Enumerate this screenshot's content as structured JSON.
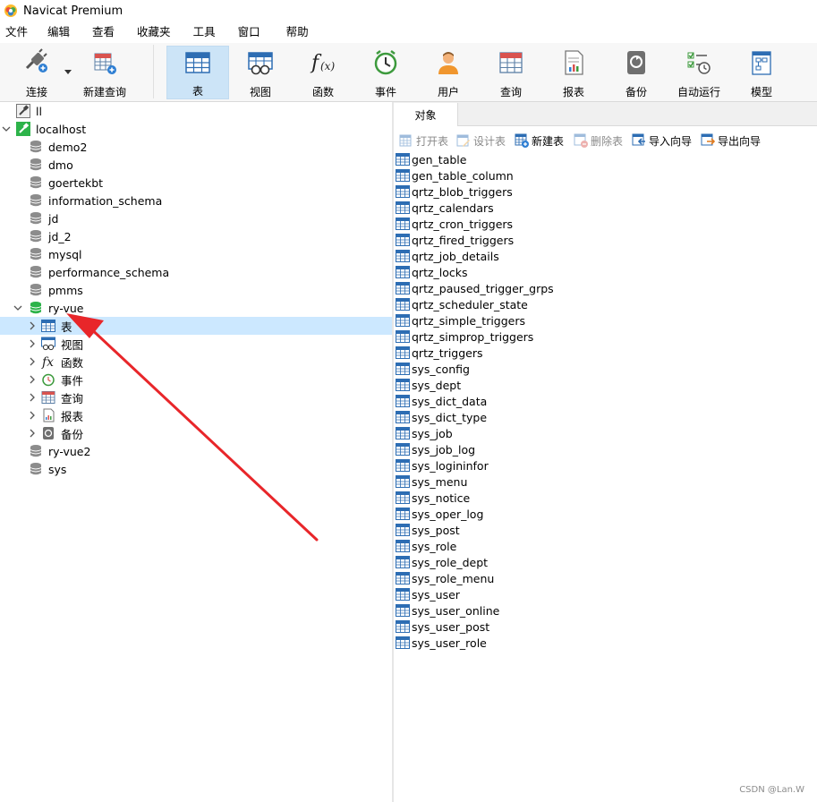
{
  "app": {
    "title": "Navicat Premium"
  },
  "menu": [
    "文件",
    "编辑",
    "查看",
    "收藏夹",
    "工具",
    "窗口",
    "帮助"
  ],
  "toolbar": [
    {
      "label": "连接",
      "icon": "plug-icon"
    },
    {
      "label": "新建查询",
      "icon": "new-query-icon"
    },
    {
      "label": "表",
      "icon": "table-icon",
      "active": true
    },
    {
      "label": "视图",
      "icon": "view-icon"
    },
    {
      "label": "函数",
      "icon": "function-icon"
    },
    {
      "label": "事件",
      "icon": "event-clock-icon"
    },
    {
      "label": "用户",
      "icon": "user-icon"
    },
    {
      "label": "查询",
      "icon": "query-icon"
    },
    {
      "label": "报表",
      "icon": "report-icon"
    },
    {
      "label": "备份",
      "icon": "backup-icon"
    },
    {
      "label": "自动运行",
      "icon": "automation-icon"
    },
    {
      "label": "模型",
      "icon": "model-icon"
    }
  ],
  "tree": {
    "connections": [
      {
        "label": "ll"
      },
      {
        "label": "localhost"
      }
    ],
    "databases": [
      "demo2",
      "dmo",
      "goertekbt",
      "information_schema",
      "jd",
      "jd_2",
      "mysql",
      "performance_schema",
      "pmms",
      "ry-vue"
    ],
    "open_db_children": [
      "表",
      "视图",
      "函数",
      "事件",
      "查询",
      "报表",
      "备份"
    ],
    "databases_after": [
      "ry-vue2",
      "sys"
    ]
  },
  "right": {
    "tab": "对象",
    "actions": [
      {
        "label": "打开表",
        "enabled": false
      },
      {
        "label": "设计表",
        "enabled": false
      },
      {
        "label": "新建表",
        "enabled": true
      },
      {
        "label": "删除表",
        "enabled": false
      },
      {
        "label": "导入向导",
        "enabled": true
      },
      {
        "label": "导出向导",
        "enabled": true
      }
    ],
    "tables": [
      "gen_table",
      "gen_table_column",
      "qrtz_blob_triggers",
      "qrtz_calendars",
      "qrtz_cron_triggers",
      "qrtz_fired_triggers",
      "qrtz_job_details",
      "qrtz_locks",
      "qrtz_paused_trigger_grps",
      "qrtz_scheduler_state",
      "qrtz_simple_triggers",
      "qrtz_simprop_triggers",
      "qrtz_triggers",
      "sys_config",
      "sys_dept",
      "sys_dict_data",
      "sys_dict_type",
      "sys_job",
      "sys_job_log",
      "sys_logininfor",
      "sys_menu",
      "sys_notice",
      "sys_oper_log",
      "sys_post",
      "sys_role",
      "sys_role_dept",
      "sys_role_menu",
      "sys_user",
      "sys_user_online",
      "sys_user_post",
      "sys_user_role"
    ]
  },
  "watermark": "CSDN @Lan.W",
  "colors": {
    "selection": "#cce8ff",
    "toolbar_active": "#cce4f7",
    "arrow": "#e8262a"
  }
}
